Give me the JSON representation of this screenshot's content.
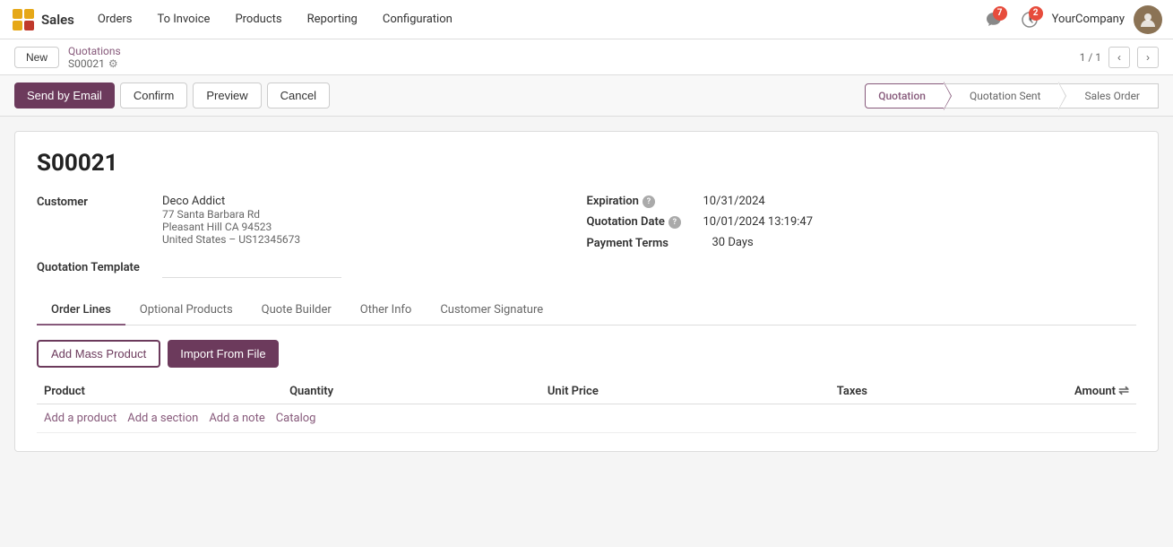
{
  "app": {
    "name": "Sales",
    "nav_links": [
      "Orders",
      "To Invoice",
      "Products",
      "Reporting",
      "Configuration"
    ],
    "notifications_count": "7",
    "activity_count": "2",
    "company": "YourCompany",
    "avatar_initial": "👤"
  },
  "breadcrumb": {
    "new_button": "New",
    "parent": "Quotations",
    "current": "S00021",
    "pagination": "1 / 1"
  },
  "toolbar": {
    "send_by_email": "Send by Email",
    "confirm": "Confirm",
    "preview": "Preview",
    "cancel": "Cancel"
  },
  "status_steps": [
    {
      "label": "Quotation",
      "active": true
    },
    {
      "label": "Quotation Sent",
      "active": false
    },
    {
      "label": "Sales Order",
      "active": false
    }
  ],
  "record": {
    "id": "S00021",
    "customer_label": "Customer",
    "customer_name": "Deco Addict",
    "customer_address_1": "77 Santa Barbara Rd",
    "customer_address_2": "Pleasant Hill CA 94523",
    "customer_address_3": "United States – US12345673",
    "quotation_template_label": "Quotation Template",
    "expiration_label": "Expiration",
    "expiration_value": "10/31/2024",
    "quotation_date_label": "Quotation Date",
    "quotation_date_value": "10/01/2024 13:19:47",
    "payment_terms_label": "Payment Terms",
    "payment_terms_value": "30 Days"
  },
  "tabs": [
    {
      "label": "Order Lines",
      "active": true
    },
    {
      "label": "Optional Products",
      "active": false
    },
    {
      "label": "Quote Builder",
      "active": false
    },
    {
      "label": "Other Info",
      "active": false
    },
    {
      "label": "Customer Signature",
      "active": false
    }
  ],
  "order_lines": {
    "add_mass_product": "Add Mass Product",
    "import_from_file": "Import From File",
    "columns": [
      {
        "label": "Product",
        "align": "left"
      },
      {
        "label": "Quantity",
        "align": "left"
      },
      {
        "label": "Unit Price",
        "align": "left"
      },
      {
        "label": "Taxes",
        "align": "left"
      },
      {
        "label": "Amount",
        "align": "right"
      }
    ],
    "add_product_link": "Add a product",
    "add_section_link": "Add a section",
    "add_note_link": "Add a note",
    "catalog_link": "Catalog"
  }
}
